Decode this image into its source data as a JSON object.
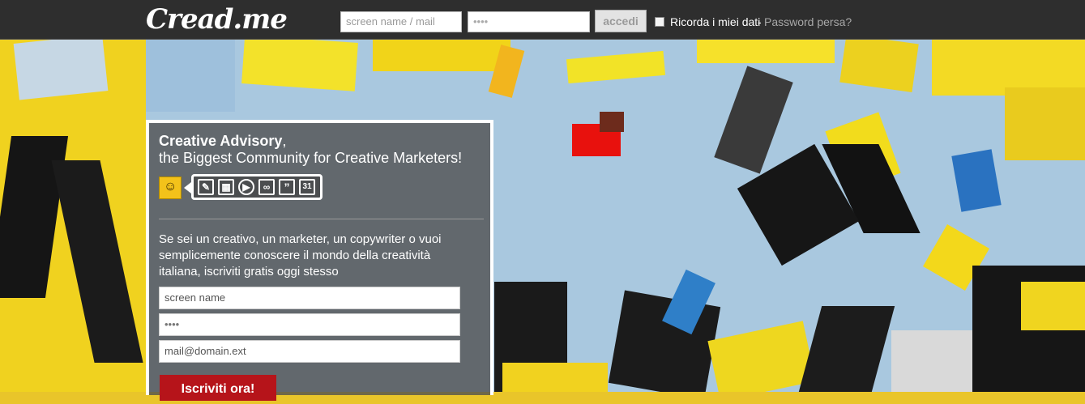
{
  "colors": {
    "topbar": "#2e2e2e",
    "accent_red": "#b6141a",
    "link_gray": "#a8a8a8"
  },
  "header": {
    "logo_text": "Cread.me",
    "login": {
      "username_placeholder": "screen name / mail",
      "password_value": "••••",
      "submit_label": "accedi",
      "remember_label": "Ricorda i miei dati",
      "separator": "-",
      "lost_password_label": "Password persa?"
    }
  },
  "signup_panel": {
    "tagline_strong": "Creative Advisory",
    "tagline_comma": ",",
    "tagline_sub": "the Biggest Community for Creative Marketers!",
    "icons": [
      "pencil-icon",
      "film-icon",
      "play-icon",
      "link-icon",
      "quote-icon",
      "calendar-icon"
    ],
    "calendar_day": "31",
    "intro_text": "Se sei un creativo, un marketer, un copywriter o vuoi semplicemente conoscere il mondo della creatività italiana, iscriviti gratis oggi stesso",
    "fields": {
      "screen_name_placeholder": "screen name",
      "password_value": "••••",
      "email_placeholder": "mail@domain.ext"
    },
    "submit_label": "Iscriviti ora!"
  }
}
